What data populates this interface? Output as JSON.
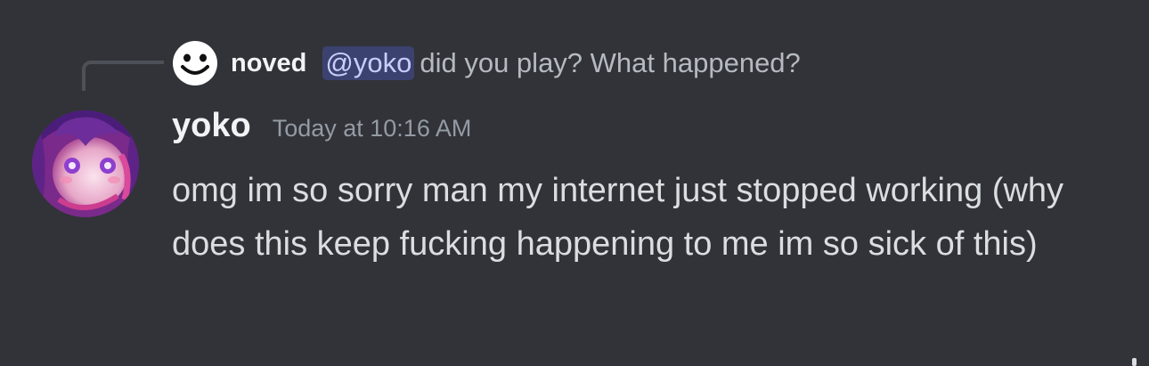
{
  "reply": {
    "avatar_icon": "smiley-face-icon",
    "author": "noved",
    "mention": "@yoko",
    "text": "did you play? What happened?"
  },
  "message": {
    "avatar_icon": "anime-avatar-icon",
    "author": "yoko",
    "timestamp": "Today at 10:16 AM",
    "content": "omg im so sorry man my internet just stopped working (why does this keep fucking happening to me im so sick of this)"
  },
  "colors": {
    "background": "#313338",
    "mention_bg": "#3c4270",
    "mention_text": "#c9cdfb",
    "username": "#f2f3f5",
    "timestamp": "#949ba4",
    "message_text": "#dbdee1"
  }
}
